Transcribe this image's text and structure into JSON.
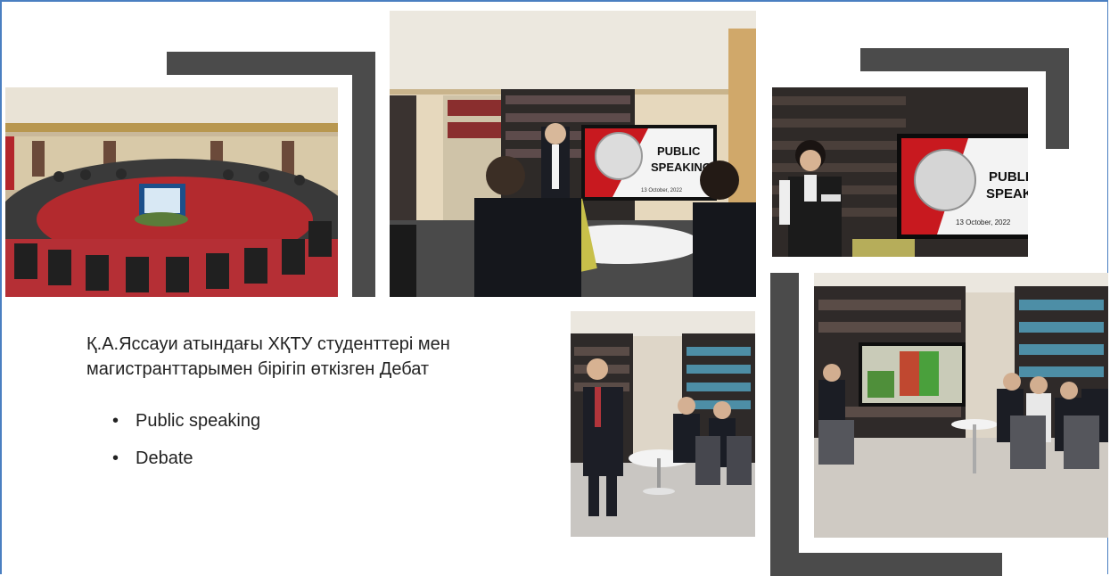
{
  "slide": {
    "caption": "Қ.А.Яссауи атындағы ХҚТУ студенттері мен магистранттарымен бірігіп өткізген Дебат",
    "bullets": [
      "Public speaking",
      "Debate"
    ],
    "bullet_symbol": "•"
  },
  "photos": {
    "screen_title_1": "PUBLIC",
    "screen_title_2": "SPEAKING",
    "screen_date": "13 October, 2022"
  },
  "colors": {
    "accent_bar": "#4b4b4b",
    "frame_border": "#4a7fc1"
  }
}
